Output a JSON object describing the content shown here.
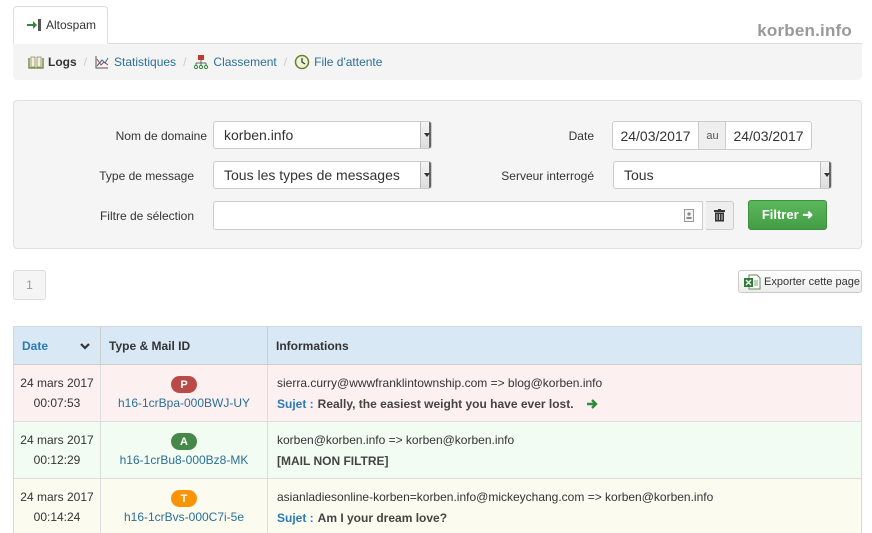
{
  "tabs": [
    {
      "label": "Altospam",
      "icon": "login-arrow-icon",
      "active": true
    }
  ],
  "brand": "korben.info",
  "breadcrumb": [
    {
      "label": "Logs",
      "icon": "book-icon",
      "active": true
    },
    {
      "label": "Statistiques",
      "icon": "chart-icon",
      "active": false
    },
    {
      "label": "Classement",
      "icon": "hierarchy-icon",
      "active": false
    },
    {
      "label": "File d'attente",
      "icon": "clock-icon",
      "active": false
    }
  ],
  "breadcrumb_separator": "/",
  "filters": {
    "domain": {
      "label": "Nom de domaine",
      "value": "korben.info"
    },
    "message_type": {
      "label": "Type de message",
      "value": "Tous les types de messages"
    },
    "selection": {
      "label": "Filtre de sélection",
      "value": ""
    },
    "date": {
      "label": "Date",
      "from": "24/03/2017",
      "separator": "au",
      "to": "24/03/2017"
    },
    "server": {
      "label": "Serveur interrogé",
      "value": "Tous"
    },
    "submit_label": "Filtrer ➜"
  },
  "pagination": {
    "current": "1"
  },
  "export_label": "Exporter cette page",
  "table": {
    "headers": [
      "Date",
      "Type & Mail ID",
      "Informations"
    ],
    "subject_key": "Sujet",
    "rows": [
      {
        "date": "24 mars 2017",
        "time": "00:07:53",
        "badge": "P",
        "badge_color": "#b94a48",
        "row_color": "#fdf0f0",
        "mail_id": "h16-1crBpa-000BWJ-UY",
        "route": "sierra.curry@wwwfranklintownship.com => blog@korben.info",
        "subject": "Really, the easiest weight you have ever lost.",
        "has_subject": true,
        "has_arrow": true
      },
      {
        "date": "24 mars 2017",
        "time": "00:12:29",
        "badge": "A",
        "badge_color": "#468847",
        "row_color": "#f2fcf2",
        "mail_id": "h16-1crBu8-000Bz8-MK",
        "route": "korben@korben.info => korben@korben.info",
        "subject": "[MAIL NON FILTRE]",
        "has_subject": false,
        "has_arrow": false
      },
      {
        "date": "24 mars 2017",
        "time": "00:14:24",
        "badge": "T",
        "badge_color": "#f89406",
        "row_color": "#fbfbef",
        "mail_id": "h16-1crBvs-000C7i-5e",
        "route": "asianladiesonline-korben=korben.info@mickeychang.com => korben@korben.info",
        "subject": "Am I your dream love?",
        "has_subject": true,
        "has_arrow": false
      }
    ]
  }
}
